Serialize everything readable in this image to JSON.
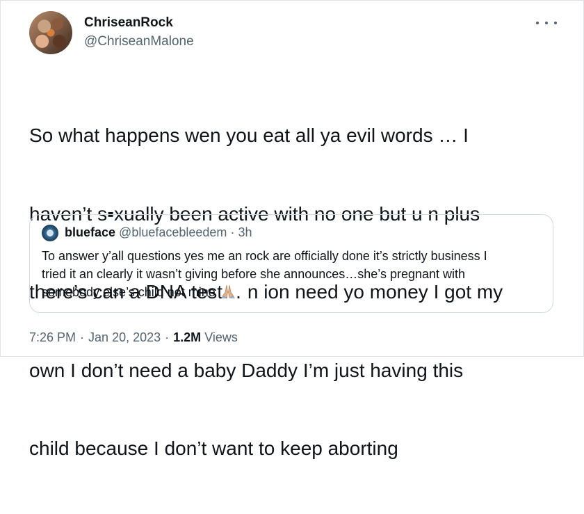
{
  "author": {
    "display_name": "ChriseanRock",
    "handle": "@ChriseanMalone"
  },
  "tweet": {
    "lines": [
      "So what happens wen you eat all ya evil words … I",
      "haven’t s▪xually been active with no one but u n plus",
      "there’s can a DNA test… n ion need yo money I got my",
      "own I don’t need a baby Daddy I’m just having this",
      "child because I don’t want to keep aborting"
    ]
  },
  "quoted": {
    "display_name": "blueface",
    "handle": "@bluefacebleedem",
    "separator": "·",
    "time": "3h",
    "lines": [
      "To answer y’all questions yes me an rock are officially done it’s strictly business I",
      "tried it an clearly it wasn’t giving before she announces…she’s pregnant with",
      "somebody else’s child not mine"
    ],
    "emoji_icon": "folded-hands-icon"
  },
  "footer": {
    "time": "7:26 PM",
    "separator": "·",
    "date": "Jan 20, 2023",
    "views_count": "1.2M",
    "views_label": "Views"
  },
  "icons": {
    "more": "more-options-icon"
  },
  "colors": {
    "text": "#0f1419",
    "secondary": "#536471",
    "border": "#cfd9de"
  }
}
